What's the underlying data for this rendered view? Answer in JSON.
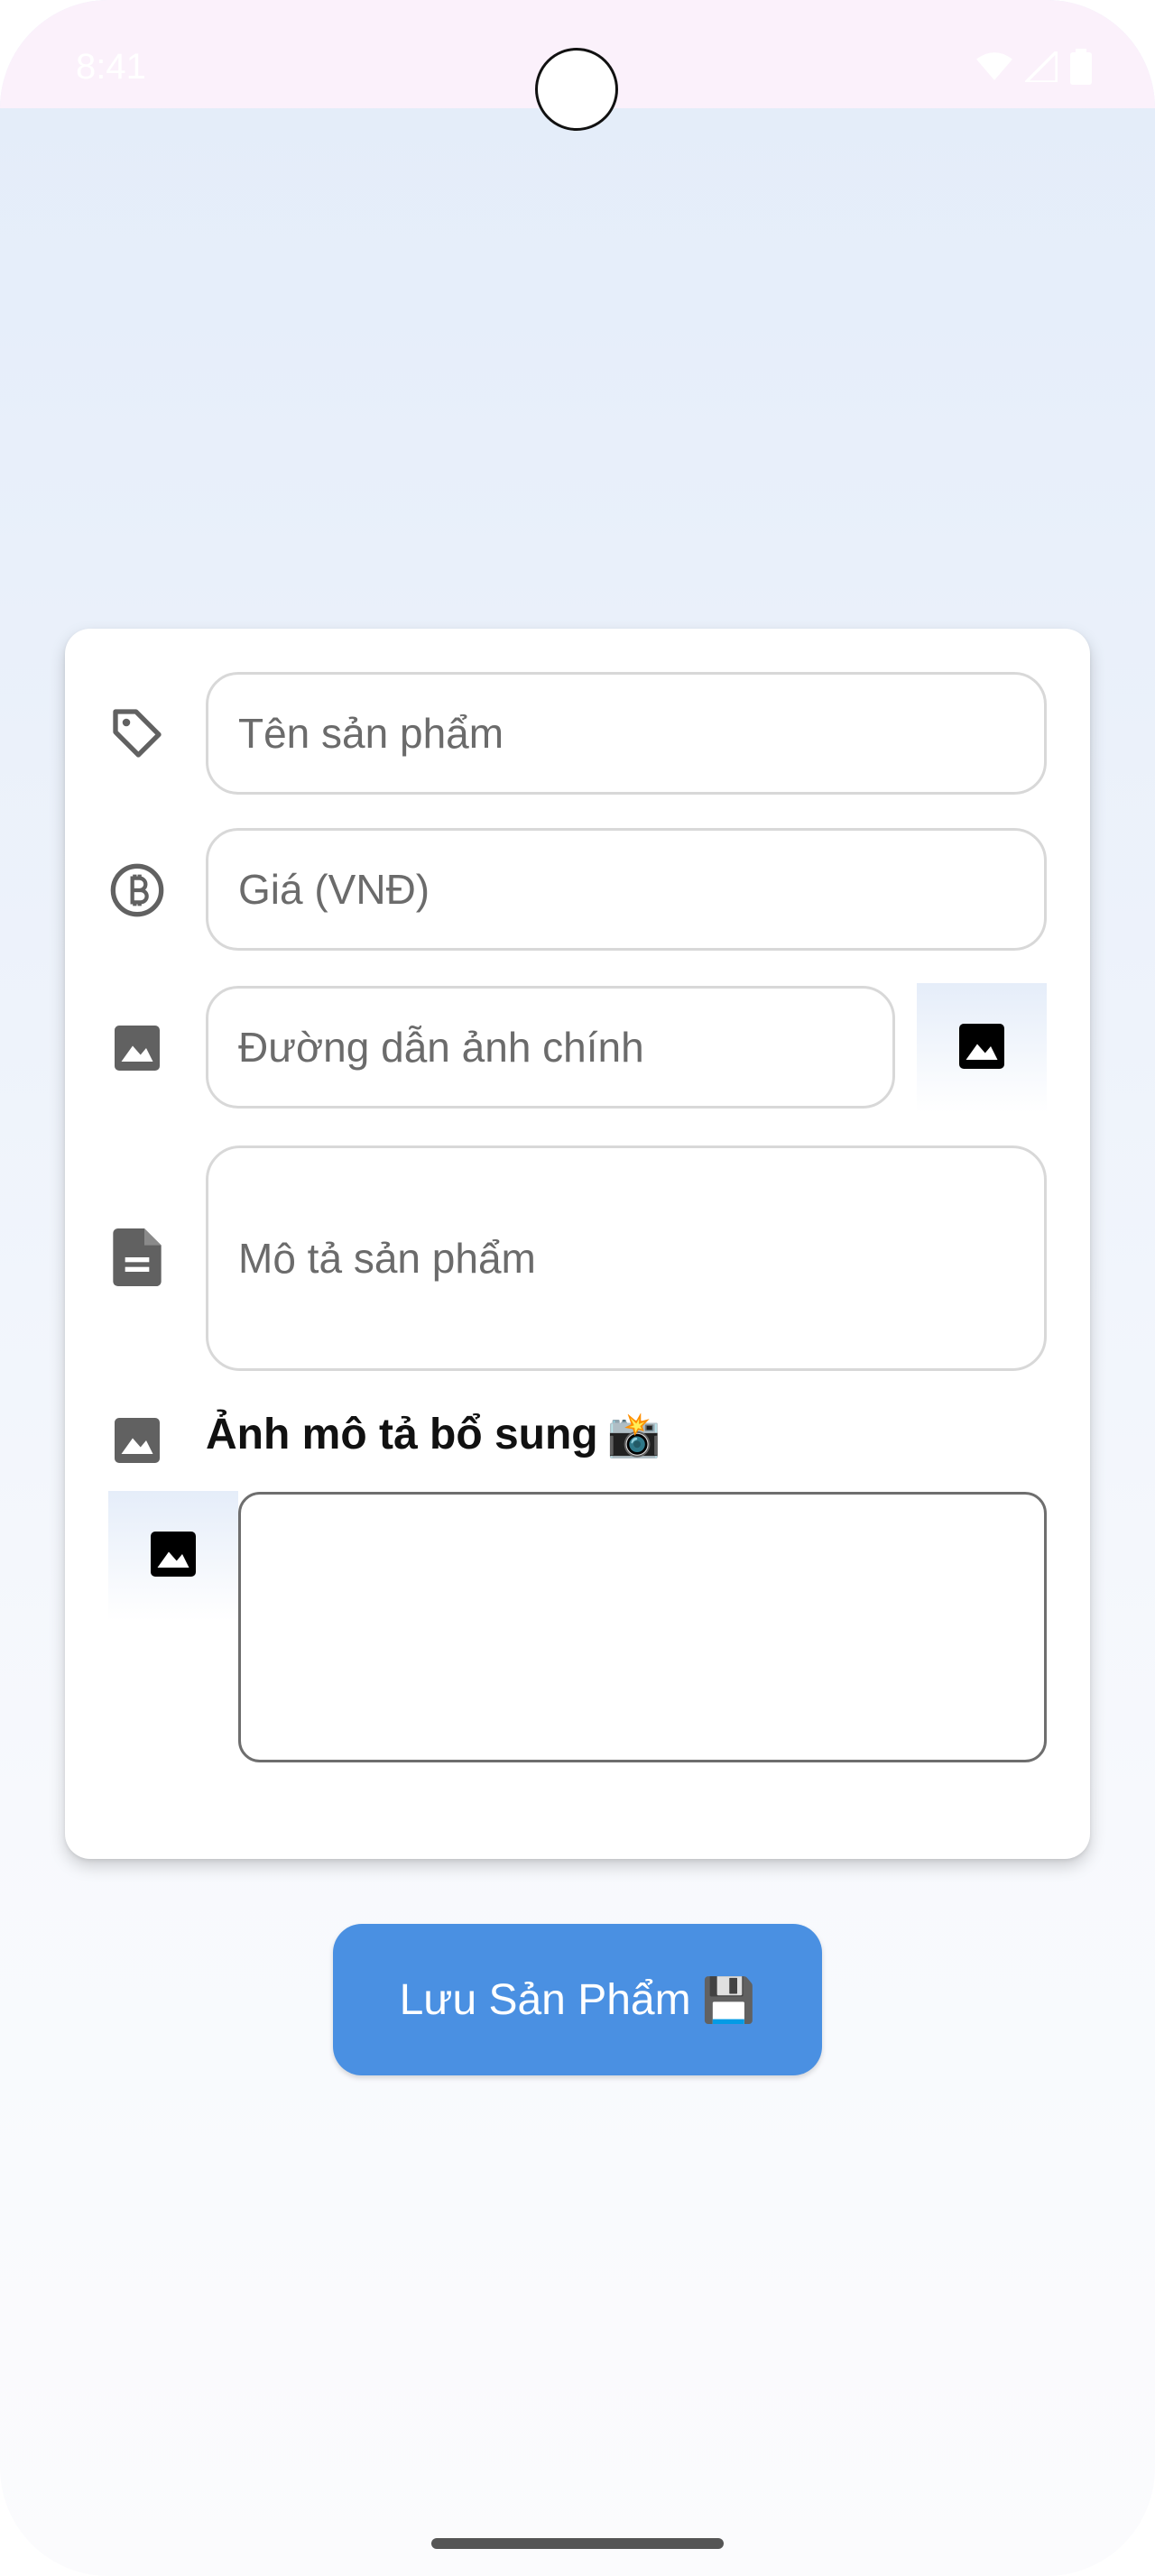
{
  "status_bar": {
    "time": "8:41"
  },
  "form": {
    "name_placeholder": "Tên sản phẩm",
    "price_placeholder": "Giá (VNĐ)",
    "image_url_placeholder": "Đường dẫn ảnh chính",
    "description_placeholder": "Mô tả sản phẩm",
    "extra_images_label": "Ảnh mô tả bổ sung",
    "extra_images_emoji": "📸"
  },
  "save_button": {
    "label": "Lưu Sản Phẩm",
    "emoji": "💾"
  },
  "icons": {
    "name": "tag-icon",
    "price": "currency-circle-icon",
    "image": "image-icon",
    "description": "document-icon",
    "picker": "image-picker-icon"
  },
  "colors": {
    "accent": "#4a90e2",
    "icon_gray": "#616161",
    "field_border": "#d8d8d8",
    "placeholder": "#6b6b6b"
  }
}
